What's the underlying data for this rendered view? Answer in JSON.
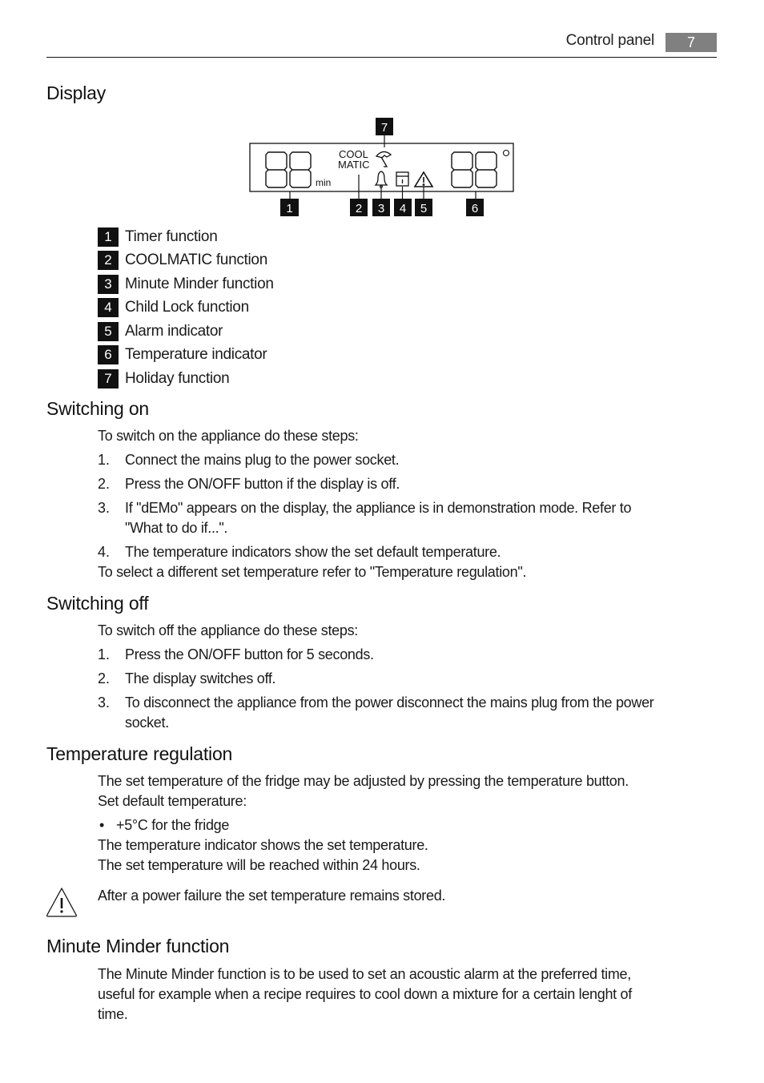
{
  "header": {
    "section_title": "Control panel",
    "page_number": "7"
  },
  "display_section": {
    "heading": "Display",
    "diagram": {
      "left_digits": "88",
      "left_unit": "min",
      "coolmatic_line1": "COOL",
      "coolmatic_line2": "MATIC",
      "right_digits": "88",
      "degree_symbol": "°",
      "callouts": [
        "1",
        "2",
        "3",
        "4",
        "5",
        "6",
        "7"
      ]
    },
    "legend": [
      {
        "num": "1",
        "label": "Timer function"
      },
      {
        "num": "2",
        "label": "COOLMATIC function"
      },
      {
        "num": "3",
        "label": "Minute Minder function"
      },
      {
        "num": "4",
        "label": "Child Lock function"
      },
      {
        "num": "5",
        "label": "Alarm indicator"
      },
      {
        "num": "6",
        "label": "Temperature indicator"
      },
      {
        "num": "7",
        "label": "Holiday function"
      }
    ]
  },
  "switching_on": {
    "heading": "Switching on",
    "intro": "To switch on the appliance do these steps:",
    "steps": [
      {
        "num": "1.",
        "text": "Connect the mains plug to the power socket."
      },
      {
        "num": "2.",
        "text": "Press the ON/OFF button if the display is off."
      },
      {
        "num": "3.",
        "text_line1": "If \"dEMo\" appears on the display, the appliance is in demonstration mode. Refer to",
        "text_line2": "\"What to do if...\"."
      },
      {
        "num": "4.",
        "text": "The temperature indicators show the set default temperature."
      }
    ],
    "outro": "To select a different set temperature refer to \"Temperature regulation\"."
  },
  "switching_off": {
    "heading": "Switching off",
    "intro": "To switch off the appliance do these steps:",
    "steps": [
      {
        "num": "1.",
        "text": "Press the ON/OFF button for 5 seconds."
      },
      {
        "num": "2.",
        "text": "The display switches off."
      },
      {
        "num": "3.",
        "text_line1": "To disconnect the appliance from the power disconnect the mains plug from the power",
        "text_line2": "socket."
      }
    ]
  },
  "temperature_regulation": {
    "heading": "Temperature regulation",
    "line1": "The set temperature of the fridge may be adjusted by pressing the temperature button.",
    "line2": "Set default temperature:",
    "bullet": "•",
    "bullet_text": "+5°C for the fridge",
    "line3": "The temperature indicator shows the set temperature.",
    "line4": "The set temperature will be reached within 24 hours.",
    "warning": "After a power failure the set temperature remains stored."
  },
  "minute_minder": {
    "heading": "Minute Minder function",
    "line1": "The Minute Minder function is to be used to set an acoustic alarm at the preferred time,",
    "line2": "useful for example when a recipe requires to cool down a mixture for a certain lenght of",
    "line3": "time."
  }
}
